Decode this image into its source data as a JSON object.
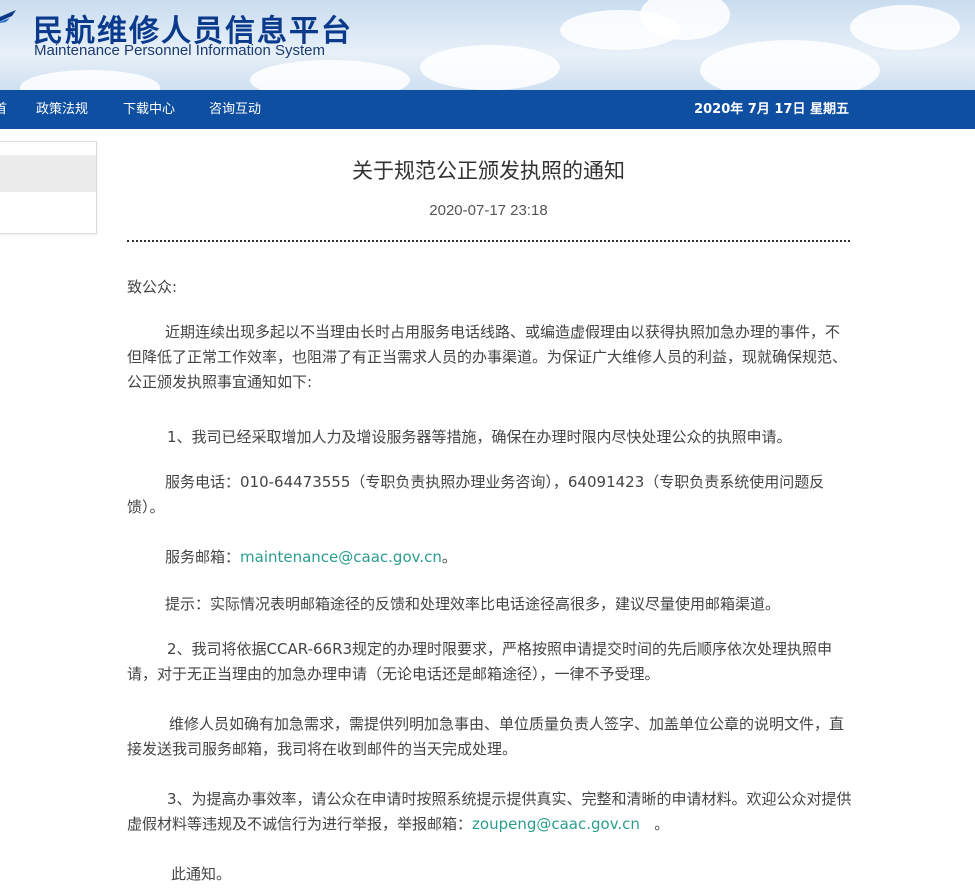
{
  "header": {
    "title": "民航维修人员信息平台",
    "subtitle": "Maintenance Personnel Information System"
  },
  "nav": {
    "items": [
      {
        "label": "首"
      },
      {
        "label": "政策法规"
      },
      {
        "label": "下载中心"
      },
      {
        "label": "咨询互动"
      }
    ],
    "date": "2020年 7月 17日 星期五"
  },
  "article": {
    "title": "关于规范公正颁发执照的通知",
    "datetime": "2020-07-17 23:18",
    "greeting": "致公众:",
    "p1": "近期连续出现多起以不当理由长时占用服务电话线路、或编造虚假理由以获得执照加急办理的事件，不但降低了正常工作效率，也阻滞了有正当需求人员的办事渠道。为保证广大维修人员的利益，现就确保规范、公正颁发执照事宜通知如下:",
    "p2": "1、我司已经采取增加人力及增设服务器等措施，确保在办理时限内尽快处理公众的执照申请。",
    "p3": "服务电话：010-64473555（专职负责执照办理业务咨询），64091423（专职负责系统使用问题反馈）。",
    "p4_prefix": "服务邮箱：",
    "p4_email": "maintenance@caac.gov.cn",
    "p4_suffix": "。",
    "p5": "提示：实际情况表明邮箱途径的反馈和处理效率比电话途径高很多，建议尽量使用邮箱渠道。",
    "p6": "2、我司将依据CCAR-66R3规定的办理时限要求，严格按照申请提交时间的先后顺序依次处理执照申请，对于无正当理由的加急办理申请（无论电话还是邮箱途径），一律不予受理。",
    "p7": "维修人员如确有加急需求，需提供列明加急事由、单位质量负责人签字、加盖单位公章的说明文件，直接发送我司服务邮箱，我司将在收到邮件的当天完成处理。",
    "p8_prefix": "3、为提高办事效率，请公众在申请时按照系统提示提供真实、完整和清晰的申请材料。欢迎公众对提供虚假材料等违规及不诚信行为进行举报，举报邮箱：",
    "p8_email": "zoupeng@caac.gov.cn",
    "p8_suffix": "。",
    "closing": "此通知。"
  },
  "colors": {
    "nav_bg": "#0f4fa1",
    "title_blue": "#0b3a8c",
    "link": "#2a9d8f"
  }
}
